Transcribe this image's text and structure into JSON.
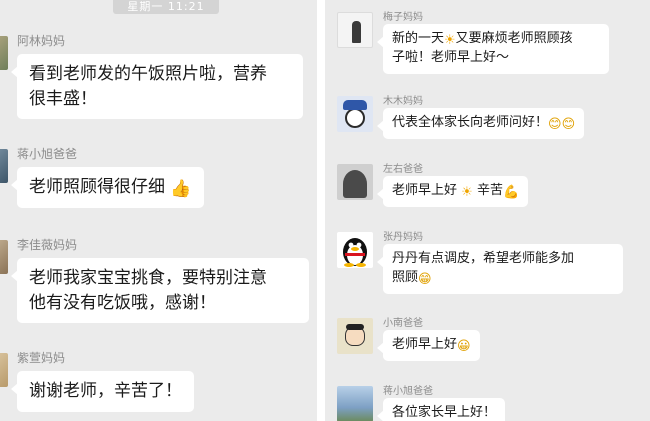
{
  "left_chat": {
    "timestamp": "星期一  11:21",
    "messages": [
      {
        "sender": "阿林妈妈",
        "lines": [
          "看到老师发的午饭照片啦，营养",
          "很丰盛！"
        ],
        "emoji": ""
      },
      {
        "sender": "蒋小旭爸爸",
        "lines": [
          "老师照顾得很仔细"
        ],
        "emoji": "👍"
      },
      {
        "sender": "李佳薇妈妈",
        "lines": [
          "老师我家宝宝挑食，要特别注意",
          "他有没有吃饭哦，感谢！"
        ],
        "emoji": ""
      },
      {
        "sender": "紫萱妈妈",
        "lines": [
          "谢谢老师，辛苦了！"
        ],
        "emoji": ""
      }
    ]
  },
  "right_chat": {
    "messages": [
      {
        "sender": "梅子妈妈",
        "text_a": "新的一天",
        "emoji_a": "☀",
        "text_b": "又要麻烦老师照顾孩",
        "text_c": "子啦！老师早上好～"
      },
      {
        "sender": "木木妈妈",
        "text_a": "代表全体家长向老师问好！",
        "emoji_a": "😊😊"
      },
      {
        "sender": "左右爸爸",
        "text_a": "老师早上好",
        "emoji_a": "☀",
        "text_b": "辛苦",
        "emoji_b": "💪"
      },
      {
        "sender": "张丹妈妈",
        "text_a": "丹丹有点调皮，希望老师能多加",
        "text_b": "照顾",
        "emoji_b": "😁"
      },
      {
        "sender": "小南爸爸",
        "text_a": "老师早上好",
        "emoji_a": "😀"
      },
      {
        "sender": "蒋小旭爸爸",
        "text_a": "各位家长早上好！"
      }
    ]
  },
  "colors": {
    "chat_background": "#ebebeb",
    "bubble": "#ffffff",
    "name_text": "#8c8c8c",
    "message_text": "#1a1a1a",
    "divider": "#ffffff"
  },
  "icons": {
    "thumbs_up": "thumbs-up-emoji",
    "sun": "sun-emoji",
    "smile": "smile-emoji",
    "grin": "grin-emoji",
    "flex": "flexed-arm-emoji"
  }
}
